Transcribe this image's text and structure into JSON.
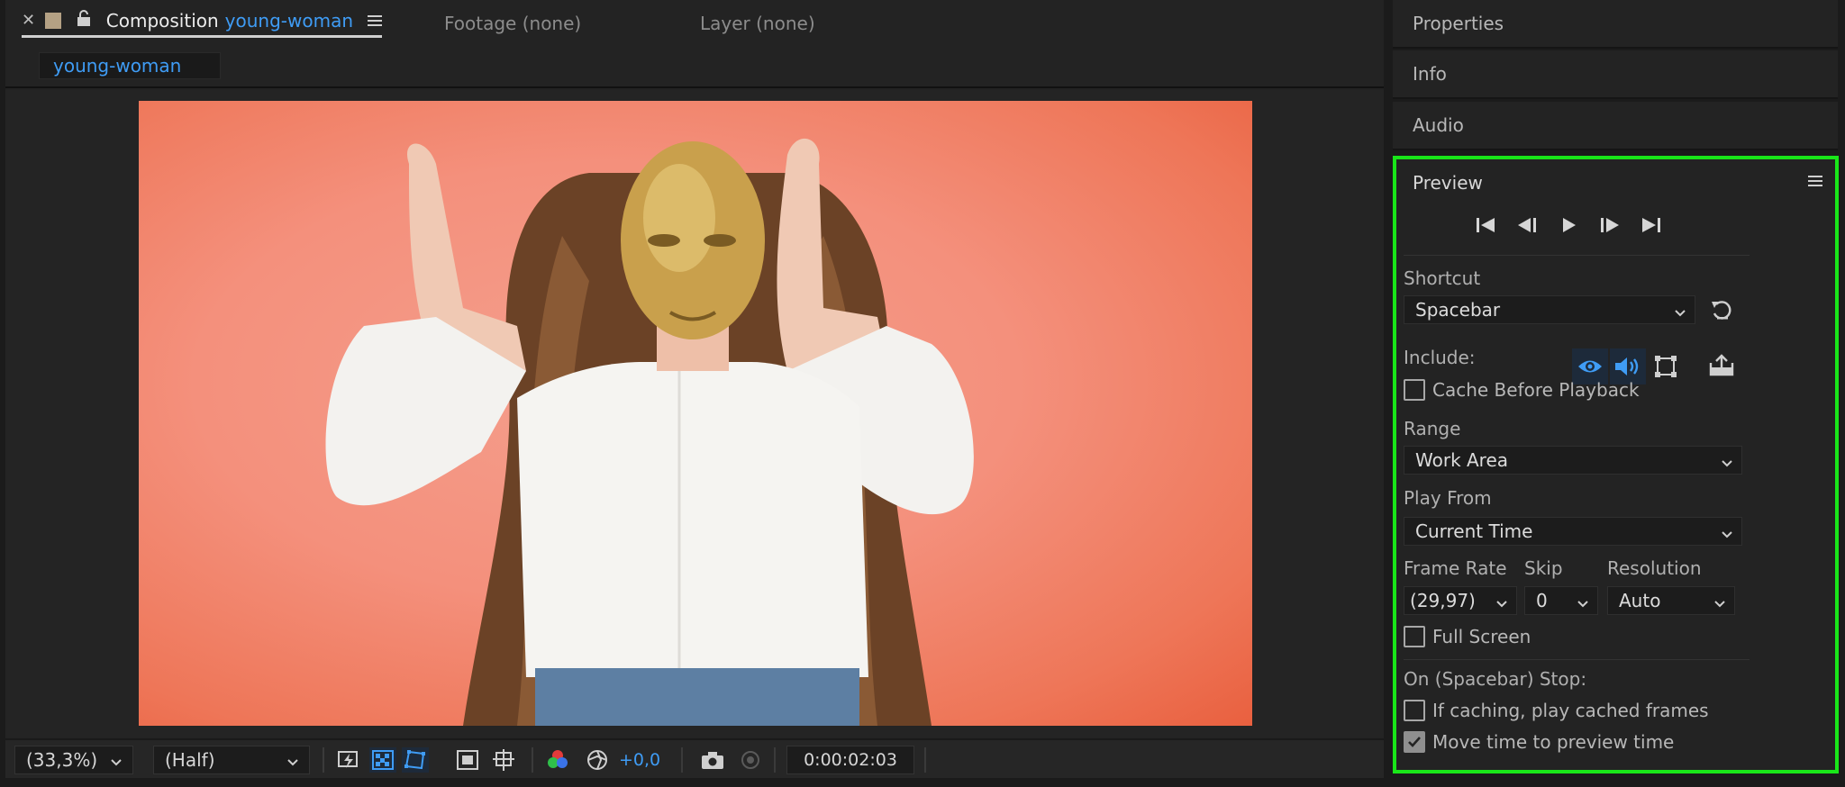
{
  "composition_panel": {
    "tab": {
      "label": "Composition",
      "name": "young-woman"
    },
    "footage_tab": "Footage (none)",
    "layer_tab": "Layer (none)",
    "subtab": "young-woman"
  },
  "viewer_bar": {
    "zoom": "(33,3%)",
    "resolution": "(Half)",
    "exposure": "+0,0",
    "timecode": "0:00:02:03"
  },
  "right_panels": {
    "properties": "Properties",
    "info": "Info",
    "audio": "Audio"
  },
  "preview": {
    "title": "Preview",
    "shortcut_label": "Shortcut",
    "shortcut_value": "Spacebar",
    "include_label": "Include:",
    "cache_before_playback": "Cache Before Playback",
    "range_label": "Range",
    "range_value": "Work Area",
    "play_from_label": "Play From",
    "play_from_value": "Current Time",
    "frame_rate_label": "Frame Rate",
    "frame_rate_value": "(29,97)",
    "skip_label": "Skip",
    "skip_value": "0",
    "resolution_label": "Resolution",
    "resolution_value": "Auto",
    "full_screen": "Full Screen",
    "on_stop_label": "On (Spacebar) Stop:",
    "if_caching": "If caching, play cached frames",
    "move_time": "Move time to preview time"
  },
  "colors": {
    "accent_blue": "#3f9cf5",
    "highlight_green": "#19e619",
    "background_salmon": "#f4907c"
  }
}
